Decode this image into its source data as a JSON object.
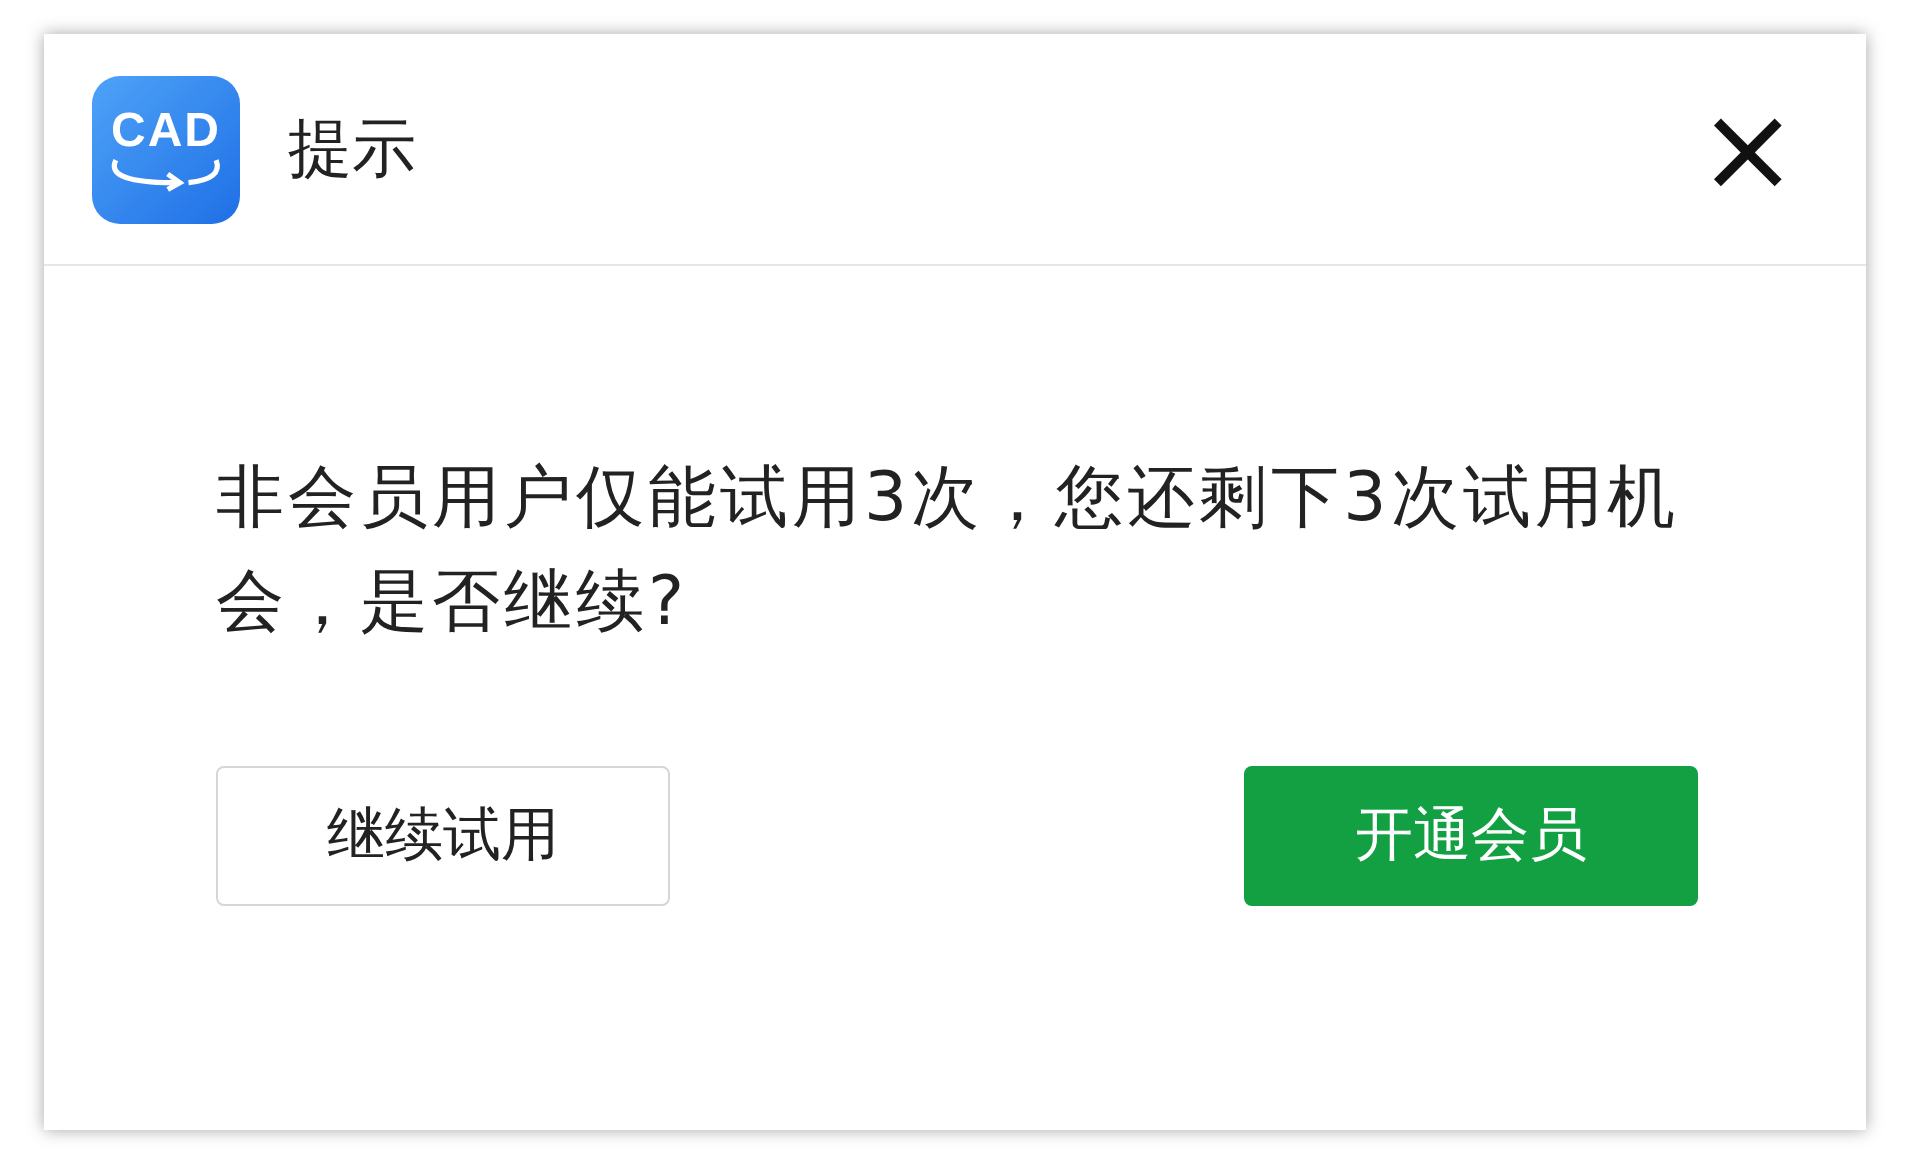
{
  "dialog": {
    "logo_text": "CAD",
    "title": "提示",
    "close": "×",
    "message": "非会员用户仅能试用3次，您还剩下3次试用机会，是否继续?",
    "buttons": [
      {
        "label": "继续试用",
        "kind": "secondary"
      },
      {
        "label": "开通会员",
        "kind": "primary"
      }
    ]
  }
}
